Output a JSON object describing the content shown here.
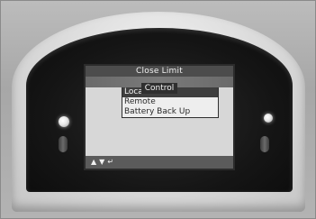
{
  "screen": {
    "title": "Close Limit",
    "subtitle": "Control",
    "menu_items": [
      {
        "label": "Local",
        "selected": true
      },
      {
        "label": "Remote",
        "selected": false
      },
      {
        "label": "Battery Back Up",
        "selected": false
      }
    ],
    "footer_icons": [
      "up-arrow-icon",
      "down-arrow-icon",
      "enter-icon"
    ]
  },
  "colors": {
    "title_bar": "#4c4c4c",
    "lcd_background": "#d7d7d7",
    "selected_row": "#3e3e3e"
  }
}
